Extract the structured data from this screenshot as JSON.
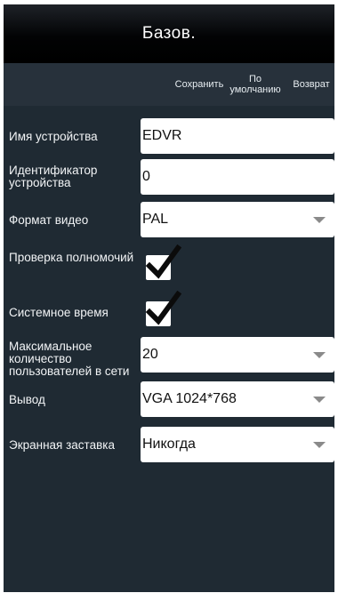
{
  "header": {
    "title": "Базов."
  },
  "toolbar": {
    "save_label": "Сохранить",
    "default_label_line1": "По",
    "default_label_line2": "умолчанию",
    "back_label": "Возврат"
  },
  "form": {
    "device_name": {
      "label": "Имя устройства",
      "value": "EDVR"
    },
    "device_id": {
      "label": "Идентификатор устройства",
      "value": "0"
    },
    "video_format": {
      "label": "Формат видео",
      "value": "PAL"
    },
    "auth_check": {
      "label": "Проверка полномочий",
      "checked": true
    },
    "system_time": {
      "label": "Системное время",
      "checked": true
    },
    "max_users": {
      "label": "Максимальное количество пользователей в сети",
      "value": "20"
    },
    "output": {
      "label": "Вывод",
      "value": "VGA 1024*768"
    },
    "screensaver": {
      "label": "Экранная заставка",
      "value": "Никогда"
    }
  },
  "colors": {
    "background": "#1f2a33",
    "toolbar": "#27313b",
    "titlebar": "#000000",
    "field": "#ffffff"
  },
  "icons": {
    "dropdown": "triangle-down",
    "checkbox": "check-mark"
  }
}
